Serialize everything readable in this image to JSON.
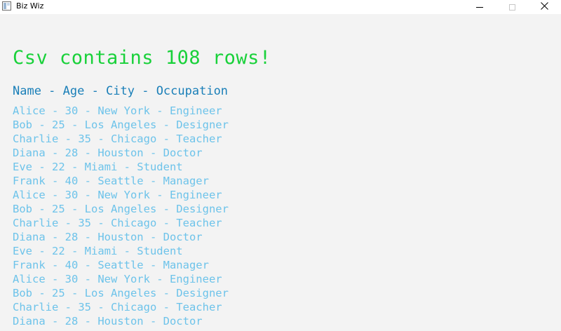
{
  "window": {
    "title": "Biz Wiz"
  },
  "main": {
    "heading": "Csv contains 108 rows!",
    "columns_line": "Name - Age - City - Occupation",
    "rows": [
      "Alice - 30 - New York - Engineer",
      "Bob - 25 - Los Angeles - Designer",
      "Charlie - 35 - Chicago - Teacher",
      "Diana - 28 - Houston - Doctor",
      "Eve - 22 - Miami - Student",
      "Frank - 40 - Seattle - Manager",
      "Alice - 30 - New York - Engineer",
      "Bob - 25 - Los Angeles - Designer",
      "Charlie - 35 - Chicago - Teacher",
      "Diana - 28 - Houston - Doctor",
      "Eve - 22 - Miami - Student",
      "Frank - 40 - Seattle - Manager",
      "Alice - 30 - New York - Engineer",
      "Bob - 25 - Los Angeles - Designer",
      "Charlie - 35 - Chicago - Teacher",
      "Diana - 28 - Houston - Doctor"
    ]
  },
  "icons": {
    "app": "app-window-icon",
    "minimize": "minimize-icon",
    "maximize": "maximize-icon",
    "close": "close-icon"
  },
  "colors": {
    "heading": "#19d13a",
    "columns_line": "#1a7fb8",
    "rows": "#6dc3ea",
    "background": "#f3f3f3"
  }
}
